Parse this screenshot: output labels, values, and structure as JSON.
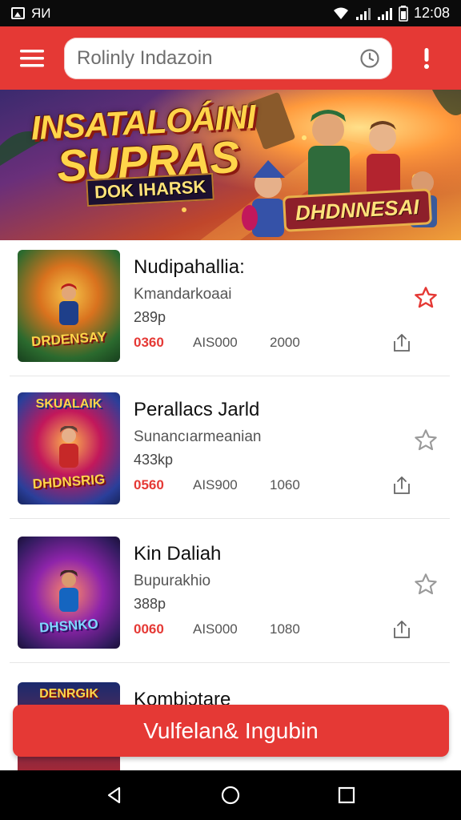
{
  "status_bar": {
    "carrier": "ЯИ",
    "time": "12:08"
  },
  "app_bar": {
    "search_placeholder": "Rolinly Indazoin"
  },
  "banner": {
    "title_line1": "INSATALOÁINI",
    "title_line2": "SUPRAS",
    "subtitle": "DOK IHARSK",
    "badge": "DHDNNESAI"
  },
  "games": [
    {
      "title": "Nudipahallia:",
      "subtitle": "Kmandarkoaai",
      "size": "289p",
      "price": "0360",
      "meta2": "AIS000",
      "meta3": "2000",
      "thumb_label": "DRDENSAY",
      "starred": true
    },
    {
      "title": "Perallacs Jarld",
      "subtitle": "Sunancıarmeanian",
      "size": "433kp",
      "price": "0560",
      "meta2": "AIS900",
      "meta3": "1060",
      "thumb_top": "SKUALAIK",
      "thumb_label": "DHDNSRIG",
      "starred": false
    },
    {
      "title": "Kin  Daliah",
      "subtitle": "Bupurakhio",
      "size": "388p",
      "price": "0060",
      "meta2": "AIS000",
      "meta3": "1080",
      "thumb_label": "DHSNKO",
      "starred": false
    },
    {
      "title": "Kombiɔtare",
      "thumb_top": "DENRGIK"
    }
  ],
  "cta": {
    "label": "Vulfelan& Ingubin"
  },
  "colors": {
    "brand_red": "#e53935",
    "status_bar": "#0b0b0b",
    "nav_bar": "#000000"
  },
  "icons": {
    "menu": "hamburger-icon",
    "clock": "clock-icon",
    "alert": "exclamation-icon",
    "star": "star-icon",
    "share": "share-icon",
    "back": "back-triangle-icon",
    "home": "home-circle-icon",
    "recents": "recents-square-icon"
  }
}
